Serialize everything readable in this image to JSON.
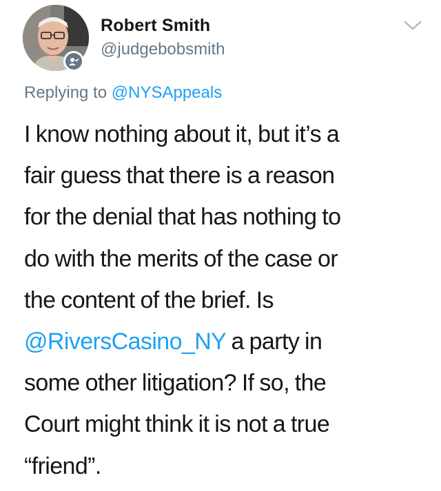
{
  "author": {
    "display_name": "Robert Smith",
    "handle": "@judgebobsmith"
  },
  "reply": {
    "prefix": "Replying to ",
    "target": "@NYSAppeals"
  },
  "tweet": {
    "lines": [
      "I know nothing about it, but it’s a",
      "fair guess that there is a reason",
      "for the denial that has nothing to",
      "do with the merits of the case or",
      "the content of the brief. Is",
      {
        "mention": "@RiversCasino_NY",
        "rest": " a party in"
      },
      "some other litigation? If so, the",
      "Court might think it is not a true",
      "“friend”."
    ]
  },
  "icons": {
    "menu": "chevron-down-icon",
    "badge": "verified-badge-icon",
    "avatar": "avatar"
  },
  "colors": {
    "text": "#14171a",
    "secondary": "#657786",
    "link": "#1da1f2",
    "background": "#ffffff"
  }
}
